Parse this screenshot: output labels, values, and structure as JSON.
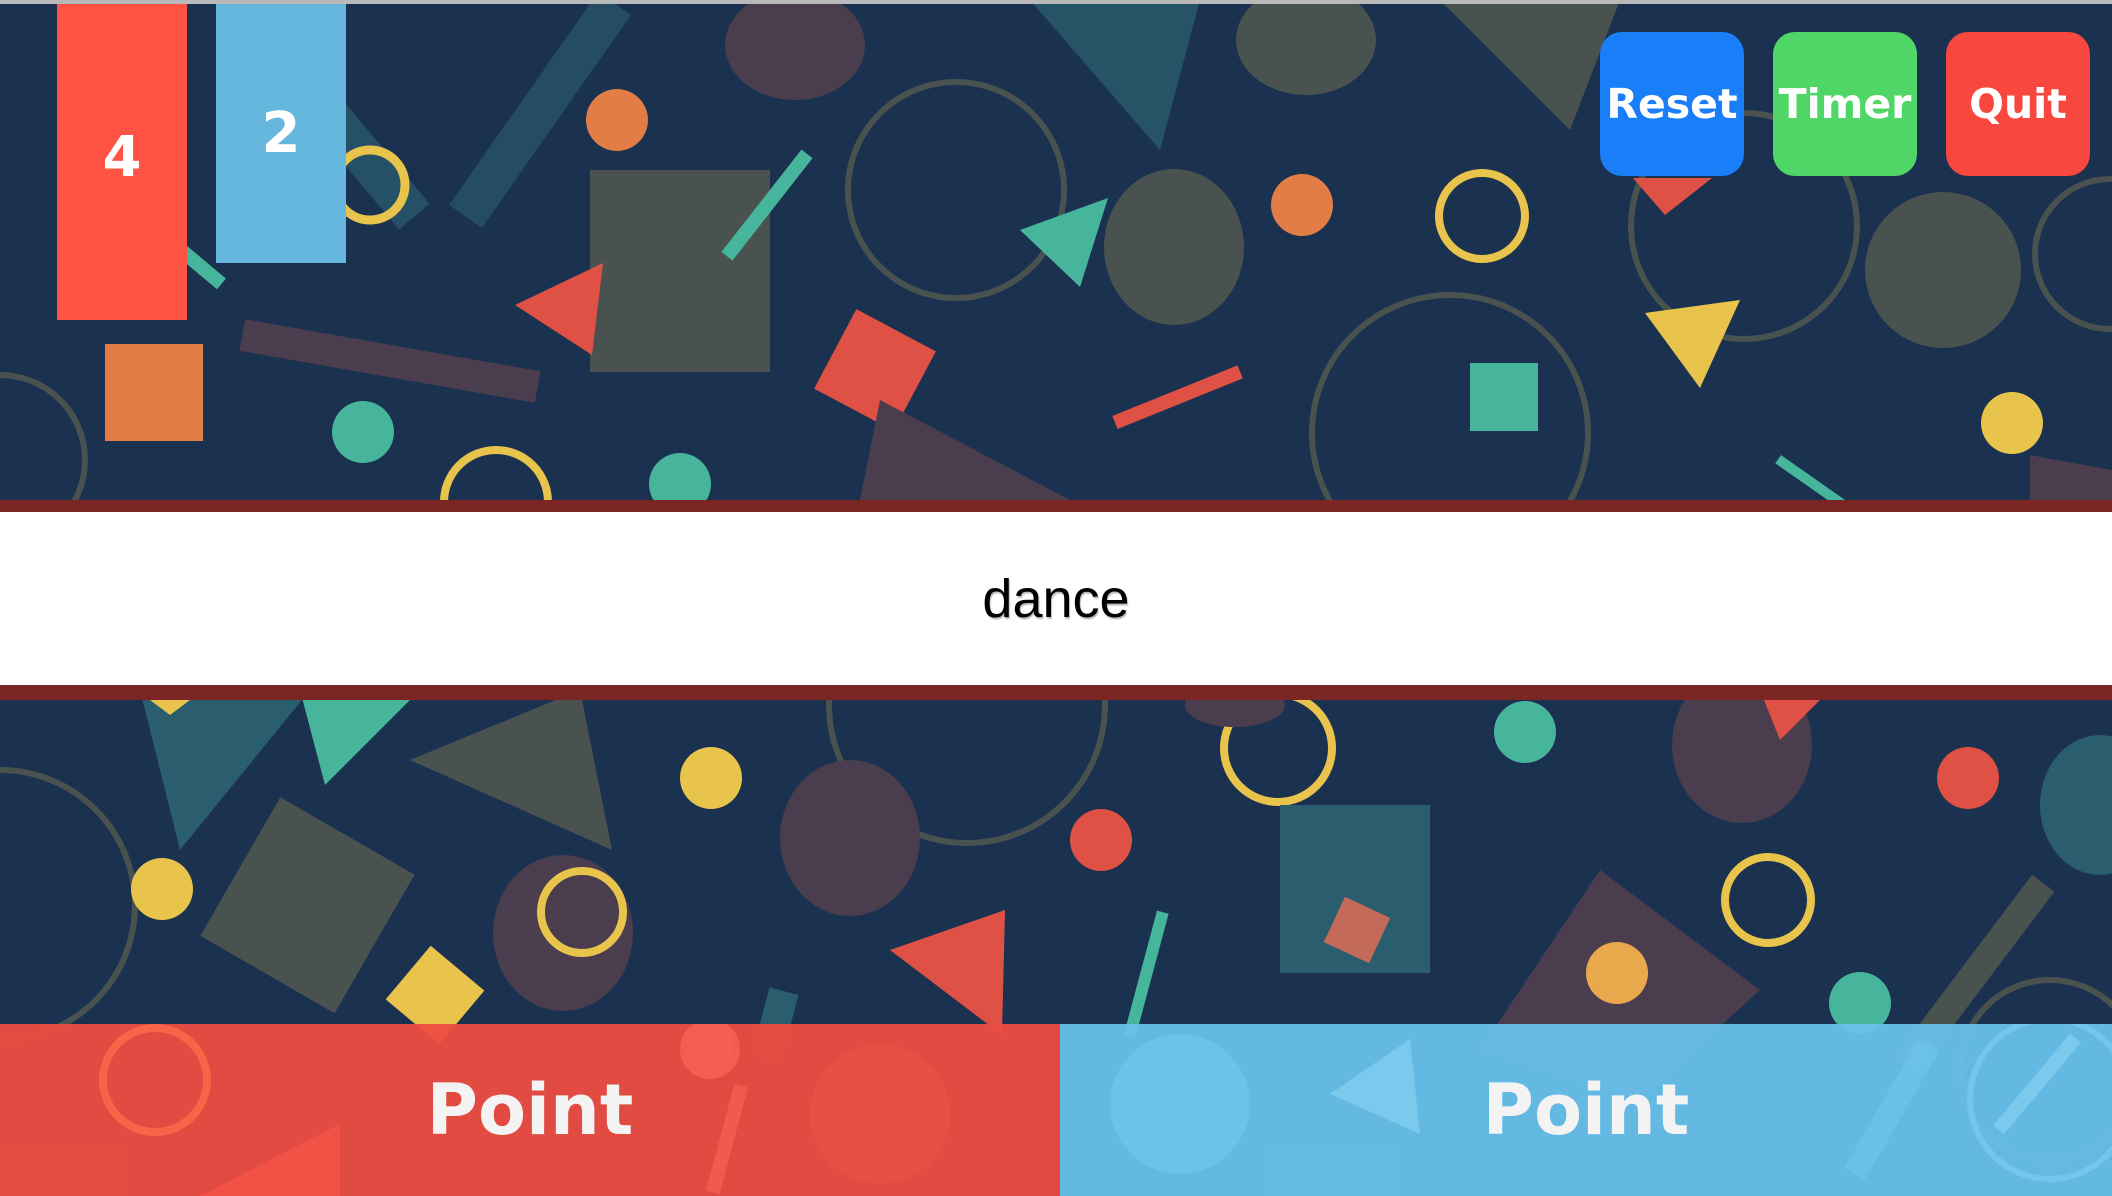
{
  "scores": {
    "red": "4",
    "blue": "2"
  },
  "controls": {
    "reset_label": "Reset",
    "timer_label": "Timer",
    "quit_label": "Quit"
  },
  "word": "dance",
  "point_buttons": {
    "red_label": "Point",
    "blue_label": "Point"
  },
  "colors": {
    "background": "#1b3150",
    "team_red": "#ff5343",
    "team_blue": "#66b7de",
    "reset": "#1a7ef8",
    "timer": "#50d666",
    "quit": "#f7473e"
  }
}
